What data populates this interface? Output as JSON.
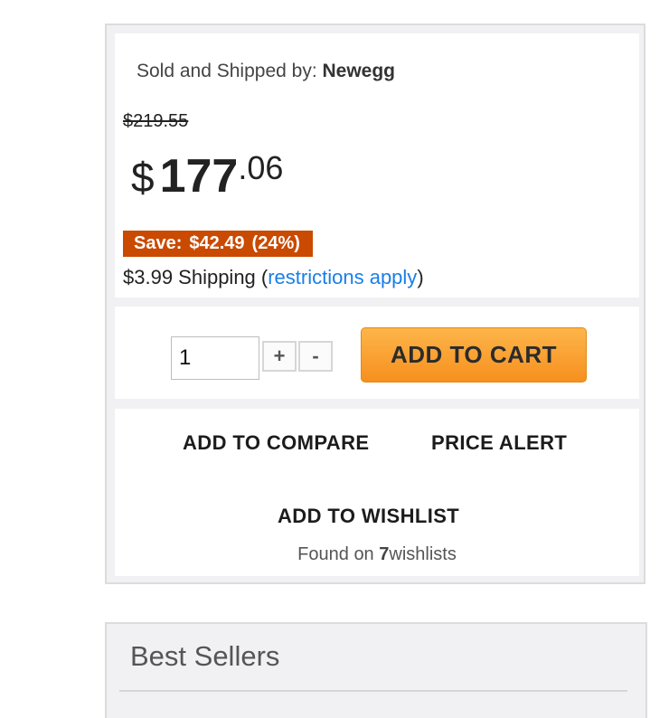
{
  "seller": {
    "prefix": "Sold and Shipped by: ",
    "name": "Newegg"
  },
  "pricing": {
    "was_price": "$219.55",
    "currency": "$",
    "dollars": "177",
    "cents": ".06",
    "save_label": "Save:",
    "save_amount": "$42.49",
    "save_percent": "(24%)",
    "shipping_prefix": "$3.99 Shipping (",
    "shipping_link": "restrictions apply",
    "shipping_suffix": ")"
  },
  "cart": {
    "quantity": "1",
    "plus_label": "+",
    "minus_label": "-",
    "add_to_cart": "ADD TO CART"
  },
  "actions": {
    "compare": "ADD TO COMPARE",
    "price_alert": "PRICE ALERT",
    "wishlist": "ADD TO WISHLIST",
    "found_prefix": "Found on ",
    "found_count": "7",
    "found_suffix": "wishlists"
  },
  "best_sellers": {
    "title": "Best Sellers"
  },
  "colors": {
    "save_badge": "#c94a00",
    "add_to_cart": "#f6901e",
    "link": "#1a7ee8"
  }
}
